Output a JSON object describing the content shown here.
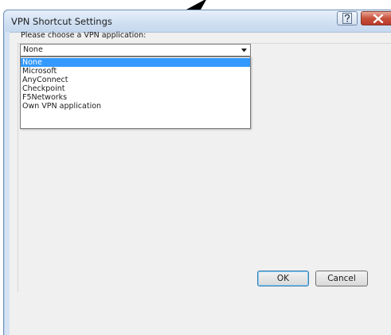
{
  "window": {
    "title": "VPN Shortcut Settings"
  },
  "form": {
    "prompt": "Please choose a VPN application:",
    "selected_value": "None",
    "options": [
      {
        "label": "None",
        "selected": true
      },
      {
        "label": "Microsoft",
        "selected": false
      },
      {
        "label": "AnyConnect",
        "selected": false
      },
      {
        "label": "Checkpoint",
        "selected": false
      },
      {
        "label": "F5Networks",
        "selected": false
      },
      {
        "label": "Own VPN application",
        "selected": false
      }
    ]
  },
  "buttons": {
    "ok_label": "OK",
    "cancel_label": "Cancel"
  },
  "icons": {
    "help": "help-icon",
    "close": "close-icon",
    "dropdown": "chevron-down-icon",
    "cursor": "cursor-arrow-icon"
  },
  "colors": {
    "selection": "#3399ff",
    "close_button": "#c8523c",
    "window_frame": "#d5e3f4"
  }
}
